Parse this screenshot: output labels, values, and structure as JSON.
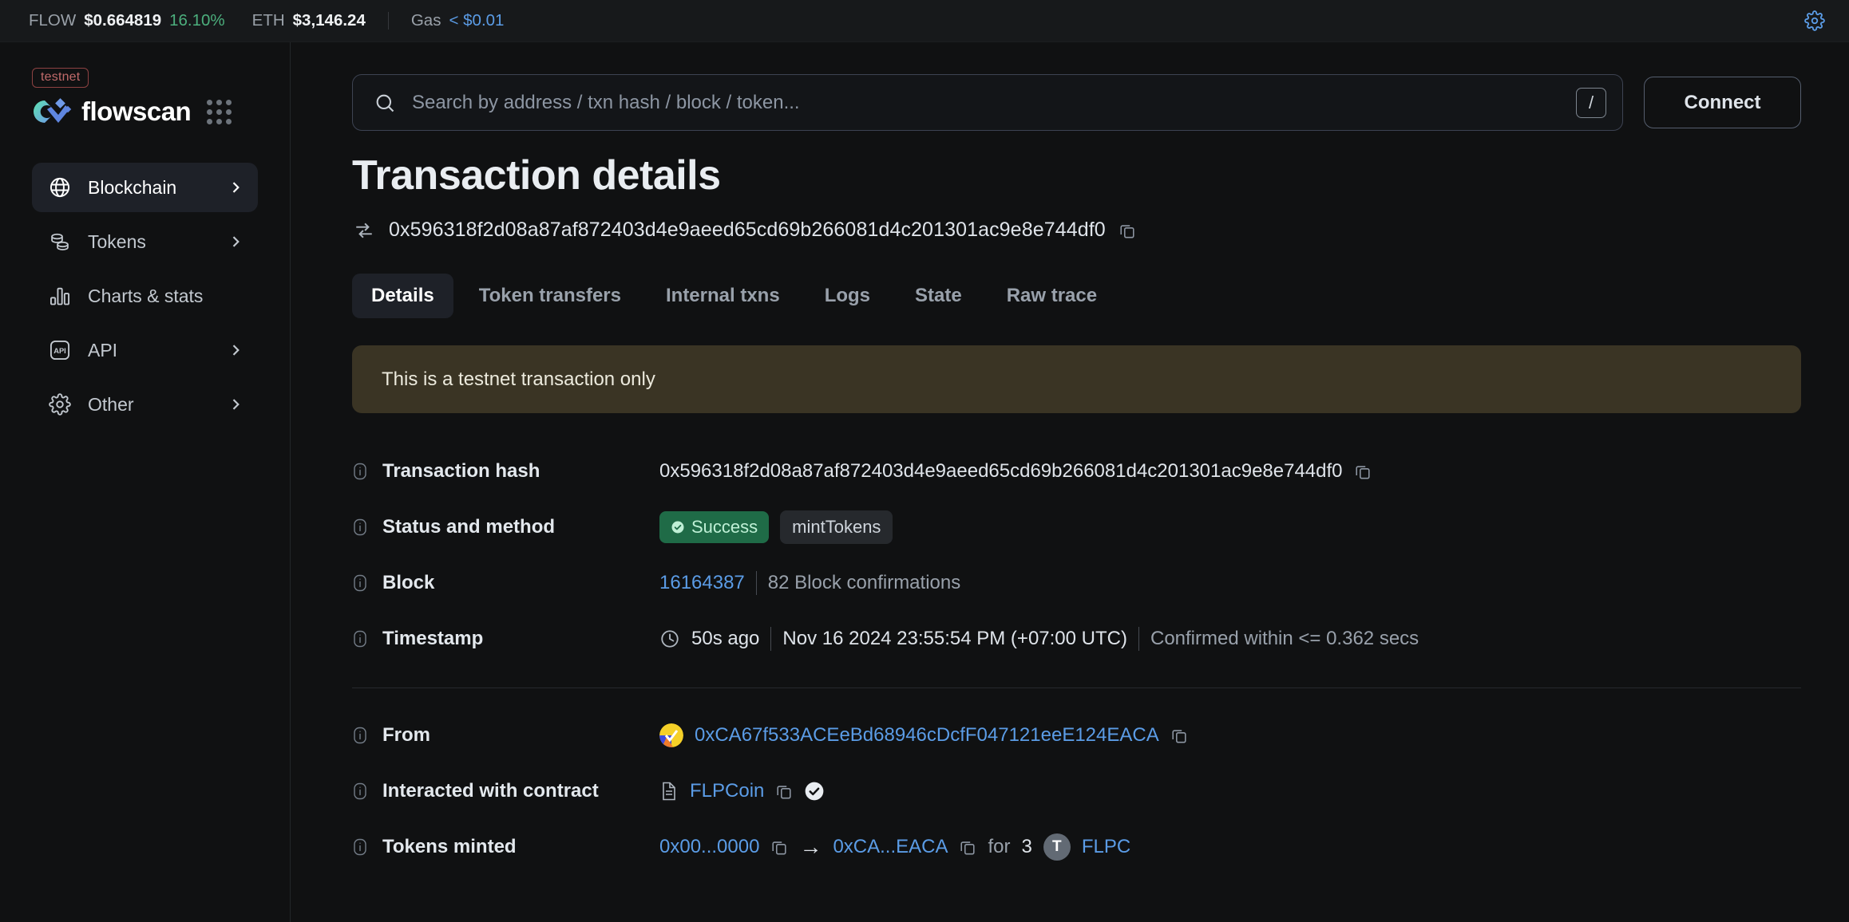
{
  "topbar": {
    "flow_label": "FLOW",
    "flow_price": "$0.664819",
    "flow_change": "16.10%",
    "eth_label": "ETH",
    "eth_price": "$3,146.24",
    "gas_label": "Gas",
    "gas_value": "< $0.01",
    "settings_icon": "gear-icon"
  },
  "sidebar": {
    "network_badge": "testnet",
    "brand": "flowscan",
    "apps_icon": "grid-dots-icon",
    "items": [
      {
        "label": "Blockchain",
        "icon": "globe-icon",
        "active": true,
        "chevron": true
      },
      {
        "label": "Tokens",
        "icon": "coins-icon",
        "active": false,
        "chevron": true
      },
      {
        "label": "Charts & stats",
        "icon": "bar-chart-icon",
        "active": false,
        "chevron": false
      },
      {
        "label": "API",
        "icon": "api-icon",
        "active": false,
        "chevron": true
      },
      {
        "label": "Other",
        "icon": "gear-icon",
        "active": false,
        "chevron": true
      }
    ]
  },
  "search": {
    "placeholder": "Search by address / txn hash / block / token...",
    "value": "",
    "icon": "search-icon",
    "shortcut_key": "/"
  },
  "header": {
    "connect_label": "Connect",
    "page_title": "Transaction details",
    "tx_hash": "0x596318f2d08a87af872403d4e9aeed65cd69b266081d4c201301ac9e8e744df0",
    "tx_icon": "arrows-exchange-icon",
    "copy_icon": "copy-icon"
  },
  "tabs": [
    {
      "label": "Details",
      "active": true
    },
    {
      "label": "Token transfers",
      "active": false
    },
    {
      "label": "Internal txns",
      "active": false
    },
    {
      "label": "Logs",
      "active": false
    },
    {
      "label": "State",
      "active": false
    },
    {
      "label": "Raw trace",
      "active": false
    }
  ],
  "notice": "This is a testnet transaction only",
  "details": {
    "transaction_hash": {
      "label": "Transaction hash",
      "value": "0x596318f2d08a87af872403d4e9aeed65cd69b266081d4c201301ac9e8e744df0"
    },
    "status_and_method": {
      "label": "Status and method",
      "status": "Success",
      "method": "mintTokens"
    },
    "block": {
      "label": "Block",
      "number": "16164387",
      "confirmations": "82 Block confirmations"
    },
    "timestamp": {
      "label": "Timestamp",
      "relative": "50s ago",
      "absolute": "Nov 16 2024 23:55:54 PM (+07:00 UTC)",
      "confirmed": "Confirmed within <= 0.362 secs"
    },
    "from": {
      "label": "From",
      "address": "0xCA67f533ACEeBd68946cDcfF047121eeE124EACA"
    },
    "interacted_with_contract": {
      "label": "Interacted with contract",
      "name": "FLPCoin"
    },
    "tokens_minted": {
      "label": "Tokens minted",
      "from_address": "0x00...0000",
      "arrow": "→",
      "to_address": "0xCA...EACA",
      "for_label": "for",
      "amount": "3",
      "token_initial": "T",
      "token_symbol": "FLPC"
    }
  },
  "colors": {
    "accent_link": "#5b9ce6",
    "success": "#1f6b47",
    "positive": "#4caf7d",
    "notice_bg": "#3a3424",
    "testnet": "#c06a6a"
  }
}
